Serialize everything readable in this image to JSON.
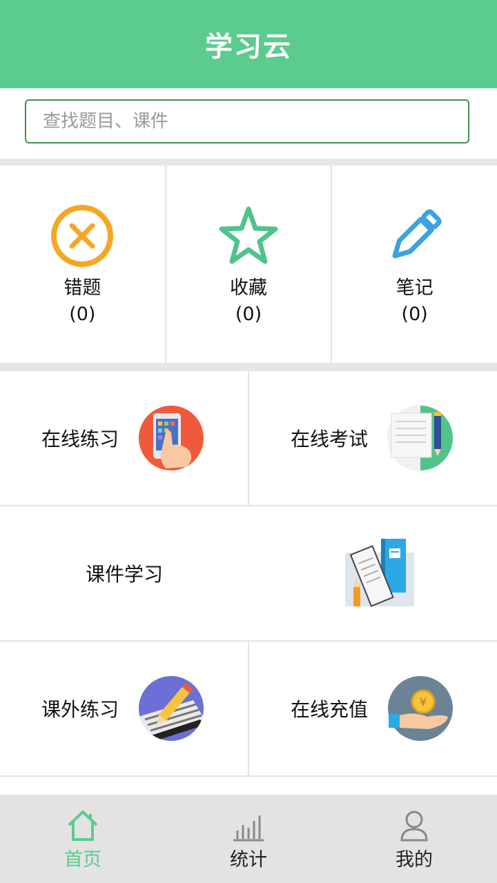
{
  "header": {
    "title": "学习云"
  },
  "search": {
    "placeholder": "查找题目、课件"
  },
  "stats": [
    {
      "label": "错题",
      "count": "(0)",
      "icon": "wrong-x-icon",
      "color": "#f5a623"
    },
    {
      "label": "收藏",
      "count": "(0)",
      "icon": "star-icon",
      "color": "#4fc38a"
    },
    {
      "label": "笔记",
      "count": "(0)",
      "icon": "pencil-icon",
      "color": "#3aa3e0"
    }
  ],
  "features": {
    "online_practice": "在线练习",
    "online_exam": "在线考试",
    "courseware": "课件学习",
    "extra_practice": "课外练习",
    "online_recharge": "在线充值"
  },
  "tabs": [
    {
      "label": "首页",
      "icon": "home-icon",
      "active": true
    },
    {
      "label": "统计",
      "icon": "bar-chart-icon",
      "active": false
    },
    {
      "label": "我的",
      "icon": "user-icon",
      "active": false
    }
  ],
  "colors": {
    "brand": "#5bcb8f",
    "divider": "#e6e6e6",
    "tabbar_bg": "#e3e3e3"
  }
}
